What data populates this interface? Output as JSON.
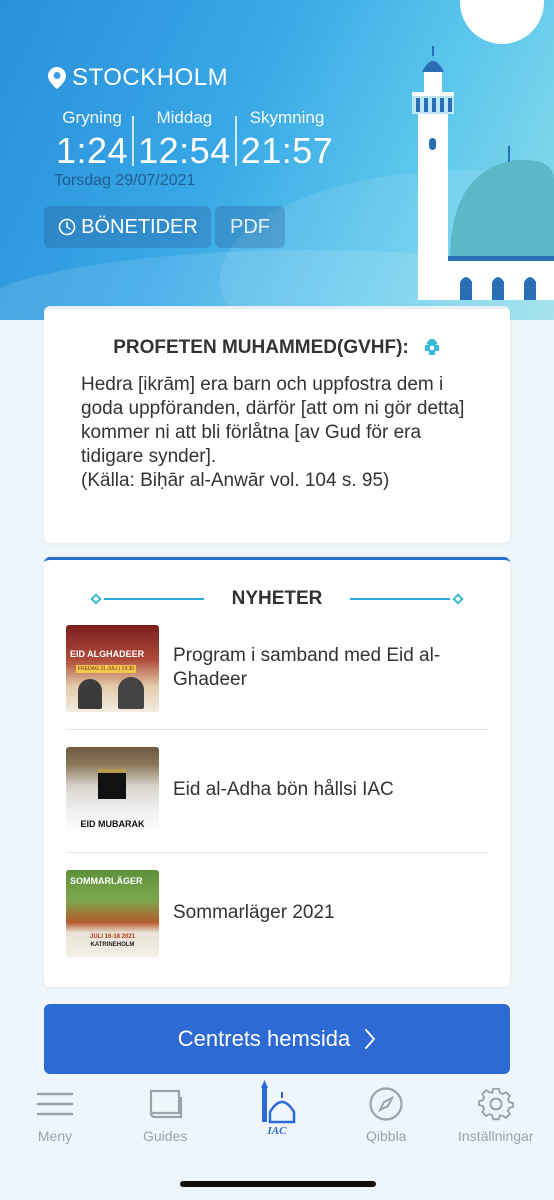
{
  "header": {
    "city": "STOCKHOLM",
    "times": [
      {
        "label": "Gryning",
        "value": "1:24"
      },
      {
        "label": "Middag",
        "value": "12:54"
      },
      {
        "label": "Skymning",
        "value": "21:57"
      }
    ],
    "date": "Torsdag  29/07/2021",
    "buttons": {
      "prayer_times": "BÖNETIDER",
      "pdf": "PDF"
    }
  },
  "quote": {
    "title": "PROFETEN MUHAMMED(GVHF):",
    "text": "Hedra [ikrām] era barn och uppfostra dem i goda uppföranden, därför [att om ni gör detta] kommer ni att bli förlåtna [av Gud för era tidigare synder].",
    "source": "(Källa: Biḥār al-Anwār vol. 104 s. 95)"
  },
  "news": {
    "title": "NYHETER",
    "items": [
      {
        "title": "Program i samband med Eid al-Ghadeer",
        "thumb_text": "EID ALGHADEER",
        "thumb_sub": "FREDAG 31 JULI | 19:30"
      },
      {
        "title": "Eid al-Adha bön hållsi IAC",
        "thumb_text": "EID MUBARAK"
      },
      {
        "title": "Sommarläger 2021",
        "thumb_text": "SOMMARLÄGER",
        "thumb_sub": "JULI 16-18 2021",
        "thumb_sub2": "KATRINEHOLM"
      }
    ]
  },
  "cta": {
    "label": "Centrets hemsida"
  },
  "tabbar": {
    "items": [
      {
        "label": "Meny",
        "icon": "menu-icon"
      },
      {
        "label": "Guides",
        "icon": "book-icon"
      },
      {
        "label": "IAC",
        "icon": "mosque-logo-icon"
      },
      {
        "label": "Qibbla",
        "icon": "compass-icon"
      },
      {
        "label": "Inställningar",
        "icon": "gear-icon"
      }
    ]
  },
  "colors": {
    "primary": "#2d6ad4",
    "accent": "#29a9d8",
    "hero_start": "#2a8fd8",
    "hero_end": "#8fdde9"
  }
}
